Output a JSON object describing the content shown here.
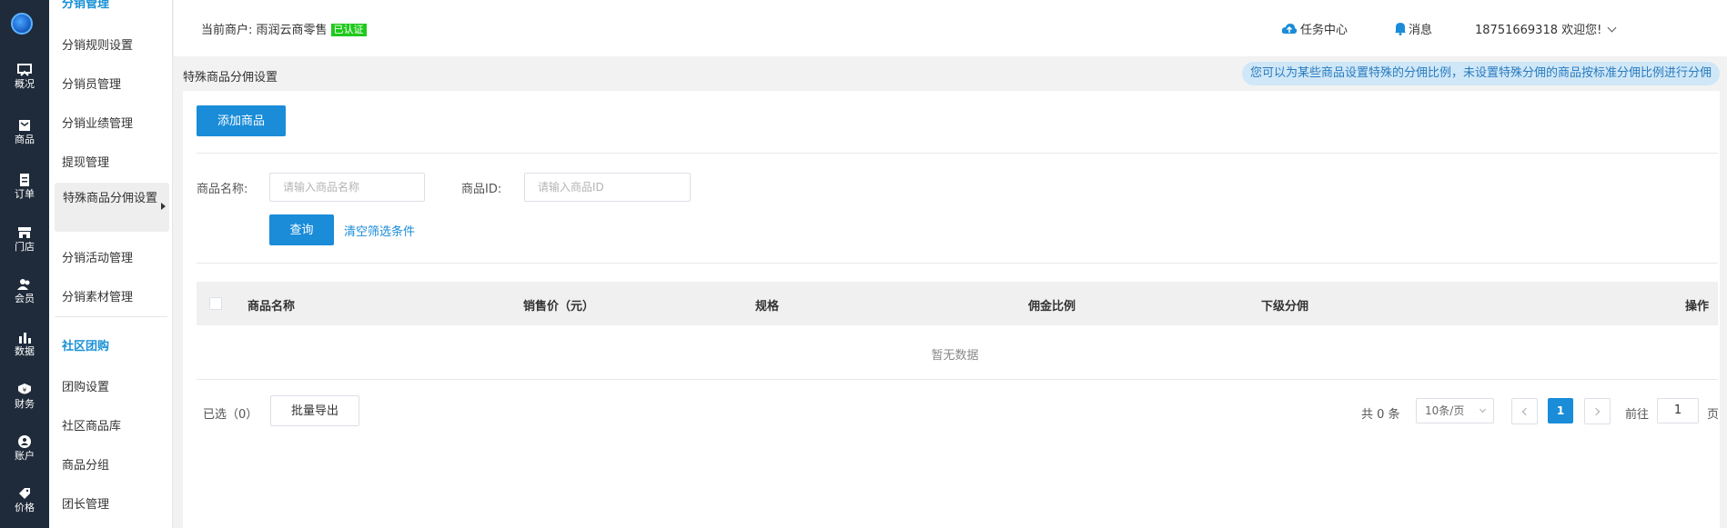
{
  "rail": {
    "items": [
      {
        "label": "概况",
        "icon": "overview-icon"
      },
      {
        "label": "商品",
        "icon": "product-icon"
      },
      {
        "label": "订单",
        "icon": "order-icon"
      },
      {
        "label": "门店",
        "icon": "store-icon"
      },
      {
        "label": "会员",
        "icon": "member-icon"
      },
      {
        "label": "数据",
        "icon": "data-icon"
      },
      {
        "label": "财务",
        "icon": "finance-icon"
      },
      {
        "label": "账户",
        "icon": "account-icon"
      },
      {
        "label": "价格",
        "icon": "price-icon"
      }
    ]
  },
  "sidebar": {
    "group_top": "分销管理",
    "items_a": [
      "分销规则设置",
      "分销员管理",
      "分销业绩管理",
      "提现管理"
    ],
    "active": "特殊商品分佣设置",
    "items_b": [
      "分销活动管理",
      "分销素材管理"
    ],
    "group2": "社区团购",
    "items_c": [
      "团购设置",
      "社区商品库",
      "商品分组",
      "团长管理"
    ]
  },
  "topbar": {
    "merchant_label": "当前商户: 雨润云商零售",
    "verified": "已认证",
    "task_center": "任务中心",
    "messages": "消息",
    "user": "18751669318 欢迎您!"
  },
  "page": {
    "title": "特殊商品分佣设置",
    "tip": "您可以为某些商品设置特殊的分佣比例，未设置特殊分佣的商品按标准分佣比例进行分佣"
  },
  "actions": {
    "add_product": "添加商品"
  },
  "filter": {
    "name_label": "商品名称:",
    "name_placeholder": "请输入商品名称",
    "id_label": "商品ID:",
    "id_placeholder": "请输入商品ID",
    "query": "查询",
    "clear": "清空筛选条件"
  },
  "table": {
    "columns": [
      "商品名称",
      "销售价（元）",
      "规格",
      "佣金比例",
      "下级分佣",
      "操作"
    ],
    "empty": "暂无数据"
  },
  "footer": {
    "selected": "已选（0）",
    "export": "批量导出",
    "total": "共 0 条",
    "page_size": "10条/页",
    "current_page": "1",
    "goto_label": "前往",
    "goto_value": "1",
    "page_unit": "页"
  },
  "colors": {
    "primary": "#1a8cd8",
    "rail": "#1f2b3a",
    "verified": "#20c91d"
  }
}
